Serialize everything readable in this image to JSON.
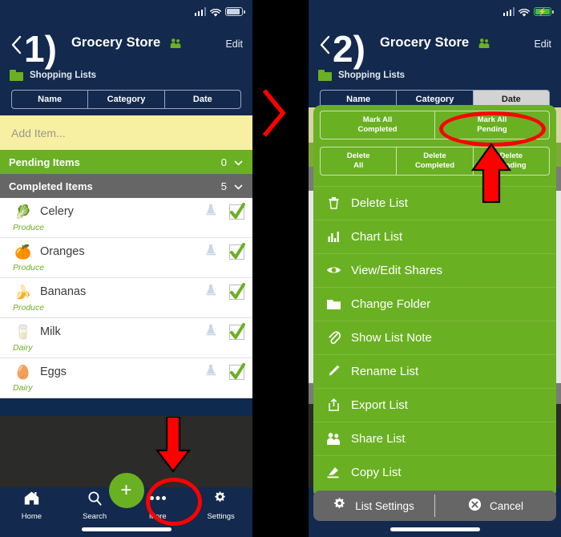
{
  "panels": [
    {
      "step_label": "1)",
      "status": {
        "battery_state": "normal"
      },
      "header": {
        "title": "Grocery Store",
        "edit": "Edit",
        "share_icon": "people-icon",
        "back_icon": "chevron-left-icon"
      },
      "breadcrumb": {
        "folder_icon": "folder-icon",
        "label": "Shopping Lists"
      },
      "segmented": {
        "options": [
          "Name",
          "Category",
          "Date"
        ],
        "selected": ""
      },
      "add_item": {
        "placeholder": "Add Item..."
      },
      "sections": [
        {
          "label": "Pending Items",
          "count": "0",
          "state": "pending"
        },
        {
          "label": "Completed Items",
          "count": "5",
          "state": "completed"
        }
      ],
      "items": [
        {
          "emoji": "🥬",
          "name": "Celery",
          "category": "Produce",
          "checked": true
        },
        {
          "emoji": "🍊",
          "name": "Oranges",
          "category": "Produce",
          "checked": true
        },
        {
          "emoji": "🍌",
          "name": "Bananas",
          "category": "Produce",
          "checked": true
        },
        {
          "emoji": "🥛",
          "name": "Milk",
          "category": "Dairy",
          "checked": true
        },
        {
          "emoji": "🥚",
          "name": "Eggs",
          "category": "Dairy",
          "checked": true
        }
      ],
      "tabbar": {
        "fab_label": "+",
        "tabs": [
          {
            "label": "Home",
            "icon": "home-icon"
          },
          {
            "label": "Search",
            "icon": "search-icon"
          },
          {
            "label": "More",
            "icon": "ellipsis-icon"
          },
          {
            "label": "Settings",
            "icon": "gear-icon"
          }
        ]
      }
    },
    {
      "step_label": "2)",
      "status": {
        "battery_state": "charging"
      },
      "header": {
        "title": "Grocery Store",
        "edit": "Edit",
        "share_icon": "people-icon",
        "back_icon": "chevron-left-icon"
      },
      "breadcrumb": {
        "folder_icon": "folder-icon",
        "label": "Shopping Lists"
      },
      "segmented": {
        "options": [
          "Name",
          "Category",
          "Date"
        ],
        "selected": "Date"
      },
      "sheet": {
        "mark_buttons": [
          "Mark All\nCompleted",
          "Mark All\nPending"
        ],
        "mark_buttons_lines": [
          [
            "Mark All",
            "Completed"
          ],
          [
            "Mark All",
            "Pending"
          ]
        ],
        "delete_buttons_lines": [
          [
            "Delete",
            "All"
          ],
          [
            "Delete",
            "Completed"
          ],
          [
            "Delete",
            "Pending"
          ]
        ],
        "menu": [
          {
            "label": "Delete List",
            "icon": "trash-icon"
          },
          {
            "label": "Chart List",
            "icon": "bar-chart-icon"
          },
          {
            "label": "View/Edit Shares",
            "icon": "eye-icon"
          },
          {
            "label": "Change Folder",
            "icon": "folder-icon"
          },
          {
            "label": "Show List Note",
            "icon": "paperclip-icon"
          },
          {
            "label": "Rename List",
            "icon": "pencil-icon"
          },
          {
            "label": "Export List",
            "icon": "export-icon"
          },
          {
            "label": "Share List",
            "icon": "people-icon"
          },
          {
            "label": "Copy List",
            "icon": "copy-icon"
          }
        ],
        "footer": {
          "settings_label": "List Settings",
          "settings_icon": "gear-icon",
          "cancel_label": "Cancel",
          "cancel_icon": "close-circle-icon"
        }
      }
    }
  ],
  "annotations": {
    "flow_arrow_icon": "chevron-right-icon",
    "highlight_color": "#ff0000",
    "panel1_target": "More",
    "panel2_target": "Mark All Pending"
  },
  "colors": {
    "nav_blue": "#13294d",
    "brand_green": "#6ab023",
    "pending_green": "#6ab023",
    "completed_gray": "#666666",
    "add_item_yellow": "#f7efa1",
    "accent_red": "#ff0000"
  }
}
